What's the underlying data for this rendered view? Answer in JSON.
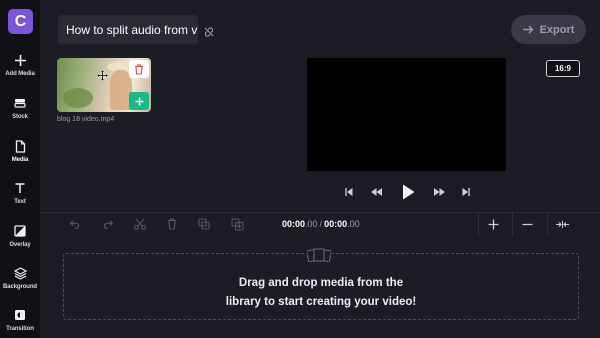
{
  "app": {
    "logo_letter": "C",
    "accent_color": "#7b57d8"
  },
  "sidebar": {
    "items": [
      {
        "label": "Add Media",
        "icon": "plus-icon"
      },
      {
        "label": "Stock",
        "icon": "stock-icon"
      },
      {
        "label": "Media",
        "icon": "file-icon"
      },
      {
        "label": "Text",
        "icon": "text-icon"
      },
      {
        "label": "Overlay",
        "icon": "overlay-icon"
      },
      {
        "label": "Background",
        "icon": "layers-icon"
      },
      {
        "label": "Transition",
        "icon": "transition-icon"
      }
    ]
  },
  "header": {
    "project_title": "How to split audio from vi",
    "export_label": "Export"
  },
  "media": {
    "items": [
      {
        "filename": "blog 18 video.mp4"
      }
    ]
  },
  "preview": {
    "aspect_ratio": "16:9"
  },
  "timeline": {
    "current_time_main": "00:00",
    "current_time_frac": ".00",
    "separator": "/",
    "total_time_main": "00:00",
    "total_time_frac": ".00",
    "drop_line1": "Drag and drop media from the",
    "drop_line2": "library to start creating your video!"
  }
}
